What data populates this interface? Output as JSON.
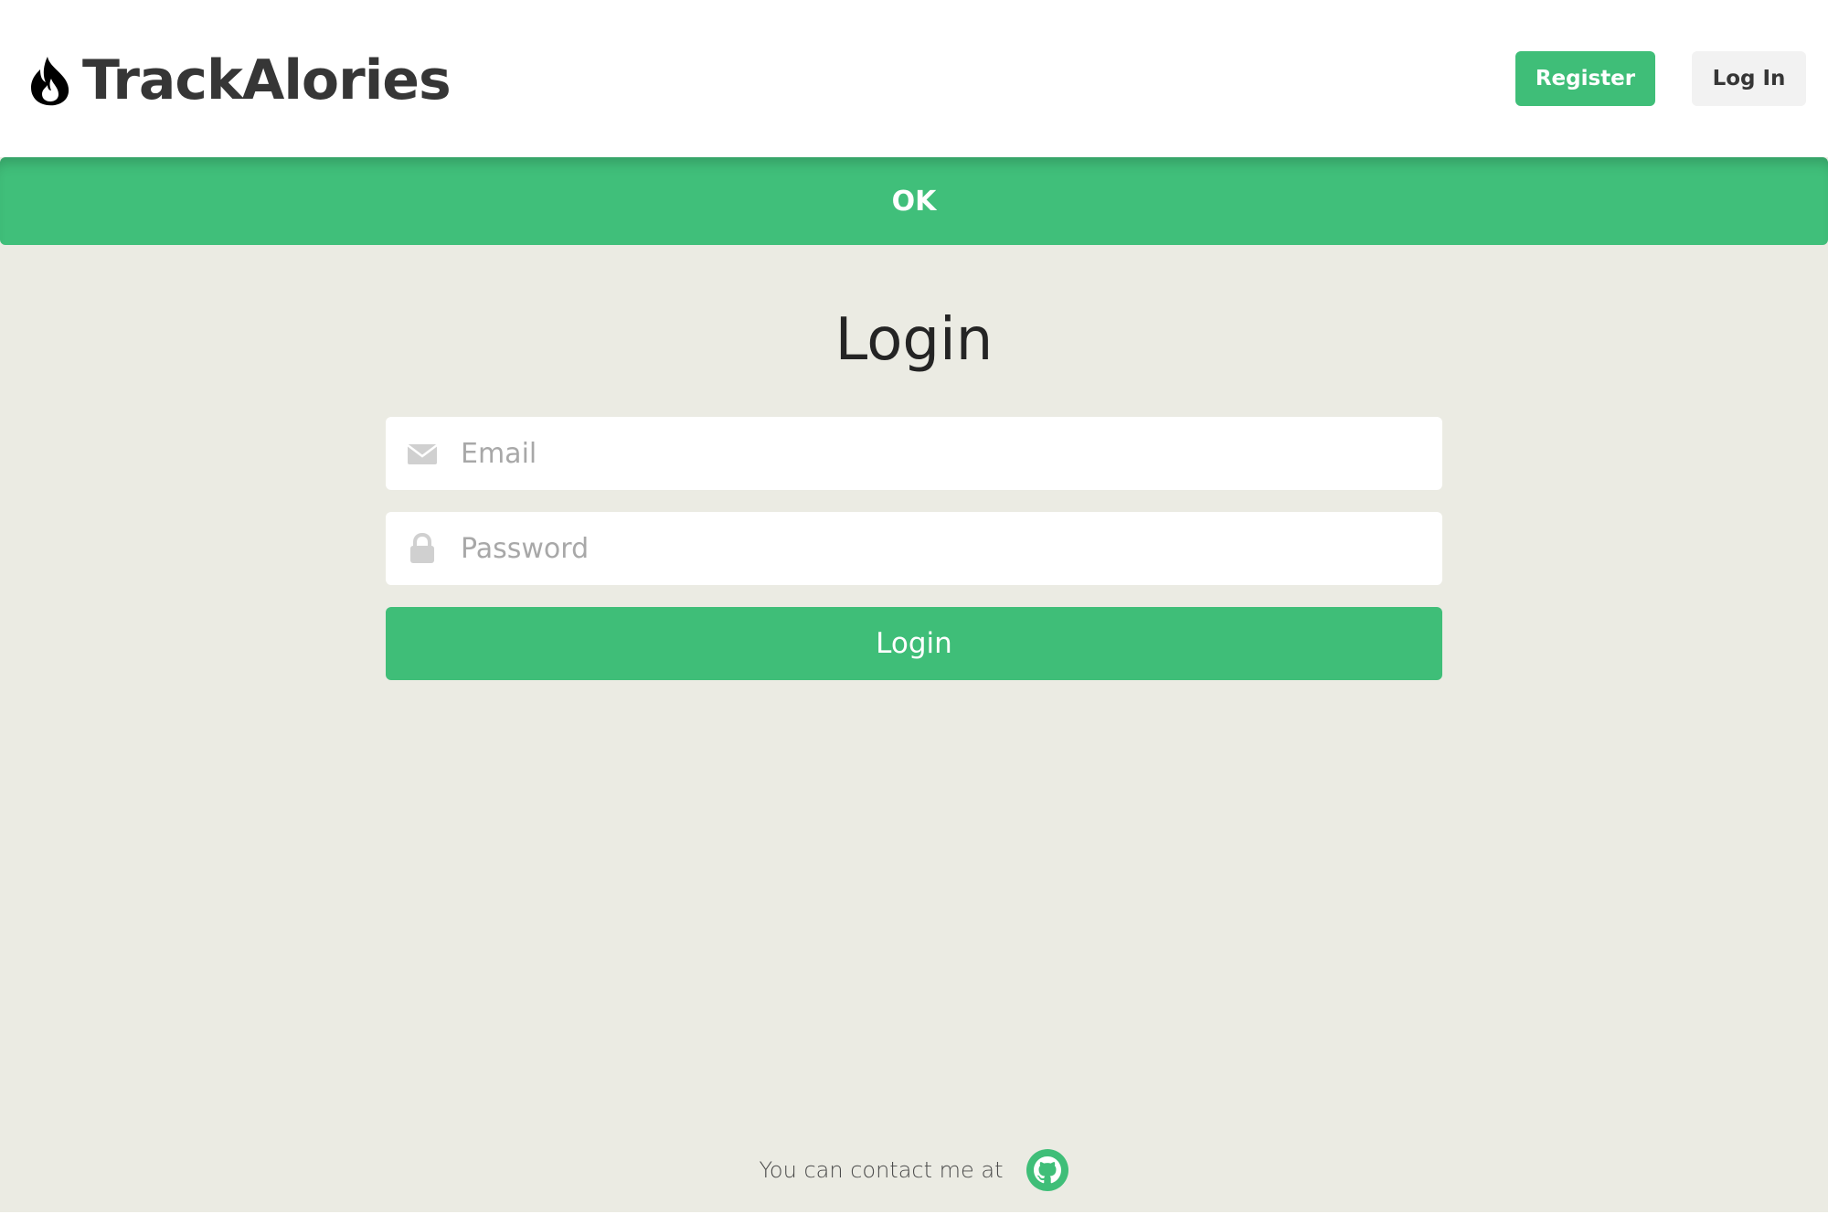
{
  "navbar": {
    "brand_name": "TrackAlories",
    "brand_icon": "fire-icon",
    "register_label": "Register",
    "login_label": "Log In"
  },
  "notification": {
    "text": "OK"
  },
  "login_form": {
    "title": "Login",
    "email": {
      "icon": "envelope-icon",
      "placeholder": "Email",
      "value": ""
    },
    "password": {
      "icon": "lock-icon",
      "placeholder": "Password",
      "value": ""
    },
    "submit_label": "Login"
  },
  "footer": {
    "text": "You can contact me at",
    "link_icon": "github-icon"
  },
  "colors": {
    "primary": "#3fbe78",
    "page_background": "#ebebe3",
    "text_dark": "#363636"
  }
}
